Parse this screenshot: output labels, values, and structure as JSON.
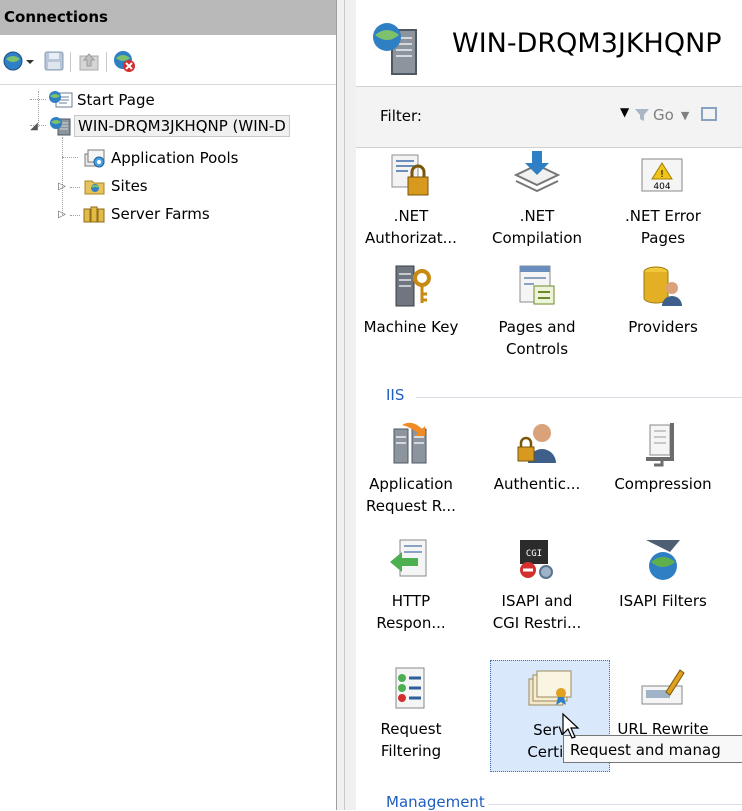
{
  "connections": {
    "header": "Connections",
    "tree": {
      "start_page": "Start Page",
      "server": "WIN-DRQM3JKHQNP (WIN-D",
      "app_pools": "Application Pools",
      "sites": "Sites",
      "server_farms": "Server Farms"
    }
  },
  "main": {
    "server_title": "WIN-DRQM3JKHQNP",
    "filter": {
      "label": "Filter:",
      "value": "",
      "go": "Go"
    },
    "tiles_top": [
      {
        "line1": ".NET",
        "line2": "Authorizat...",
        "icon": "lock-doc-icon"
      },
      {
        "line1": ".NET",
        "line2": "Compilation",
        "icon": "stack-download-icon"
      },
      {
        "line1": ".NET Error",
        "line2": "Pages",
        "icon": "warning-404-icon"
      },
      {
        "line1": "Machine Key",
        "line2": "",
        "icon": "server-key-icon"
      },
      {
        "line1": "Pages and",
        "line2": "Controls",
        "icon": "pages-icon"
      },
      {
        "line1": "Providers",
        "line2": "",
        "icon": "db-user-icon"
      }
    ],
    "group_iis": "IIS",
    "tiles_iis": [
      {
        "line1": "Application",
        "line2": "Request R...",
        "icon": "server-arrow-icon"
      },
      {
        "line1": "Authentic...",
        "line2": "",
        "icon": "user-lock-icon"
      },
      {
        "line1": "Compression",
        "line2": "",
        "icon": "clamp-icon"
      },
      {
        "line1": "HTTP",
        "line2": "Respon...",
        "icon": "http-arrow-icon"
      },
      {
        "line1": "ISAPI and",
        "line2": "CGI Restri...",
        "icon": "cgi-icon"
      },
      {
        "line1": "ISAPI Filters",
        "line2": "",
        "icon": "globe-funnel-icon"
      },
      {
        "line1": "Request",
        "line2": "Filtering",
        "icon": "checklist-icon"
      },
      {
        "line1": "Serv",
        "line2": "Certifi",
        "icon": "certificate-icon"
      },
      {
        "line1": "URL Rewrite",
        "line2": "",
        "icon": "pencil-window-icon"
      }
    ],
    "group_management": "Management",
    "tooltip": "Request and manag"
  }
}
